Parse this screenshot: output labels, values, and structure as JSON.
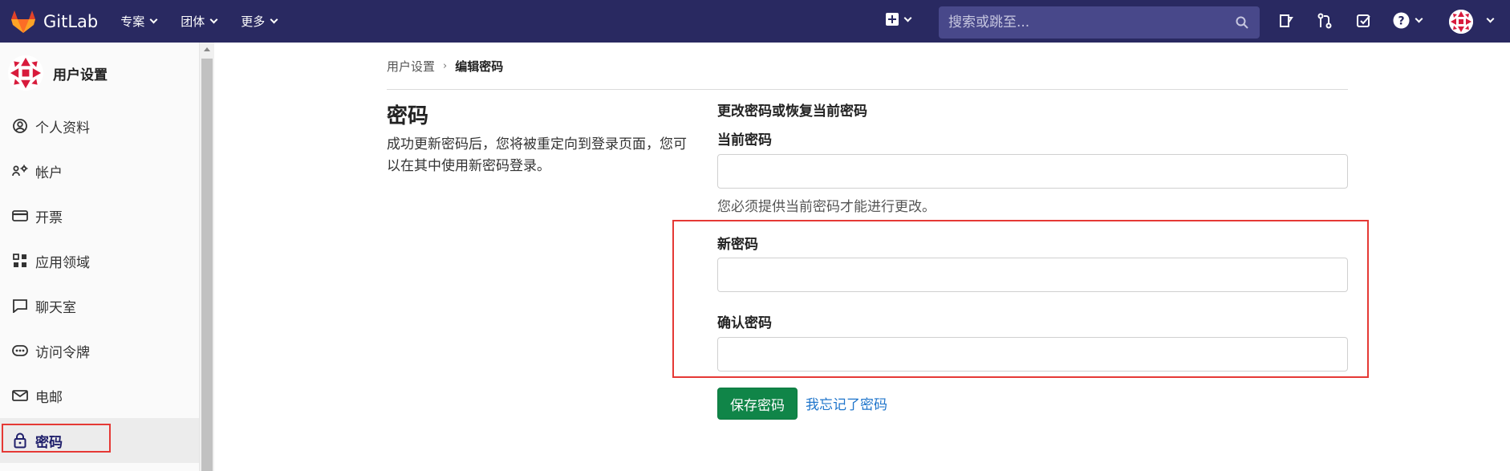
{
  "topbar": {
    "brand": "GitLab",
    "nav": [
      "专案",
      "团体",
      "更多"
    ],
    "search_placeholder": "搜索或跳至..."
  },
  "sidebar": {
    "title": "用户设置",
    "items": [
      {
        "label": "个人资料",
        "icon": "user-circle-icon"
      },
      {
        "label": "帐户",
        "icon": "account-settings-icon"
      },
      {
        "label": "开票",
        "icon": "credit-card-icon"
      },
      {
        "label": "应用领域",
        "icon": "applications-grid-icon"
      },
      {
        "label": "聊天室",
        "icon": "chat-bubble-icon"
      },
      {
        "label": "访问令牌",
        "icon": "token-icon"
      },
      {
        "label": "电邮",
        "icon": "mail-icon"
      },
      {
        "label": "密码",
        "icon": "lock-icon",
        "active": true
      }
    ]
  },
  "breadcrumb": {
    "parent": "用户设置",
    "current": "编辑密码"
  },
  "main": {
    "left_title": "密码",
    "left_description": "成功更新密码后，您将被重定向到登录页面，您可以在其中使用新密码登录。",
    "section_title": "更改密码或恢复当前密码",
    "current_password_label": "当前密码",
    "current_password_help": "您必须提供当前密码才能进行更改。",
    "new_password_label": "新密码",
    "confirm_password_label": "确认密码",
    "save_button": "保存密码",
    "forgot_link": "我忘记了密码"
  },
  "colors": {
    "topbar": "#292961",
    "save_button": "#108548",
    "link": "#1f75cb",
    "highlight": "#e53935"
  }
}
